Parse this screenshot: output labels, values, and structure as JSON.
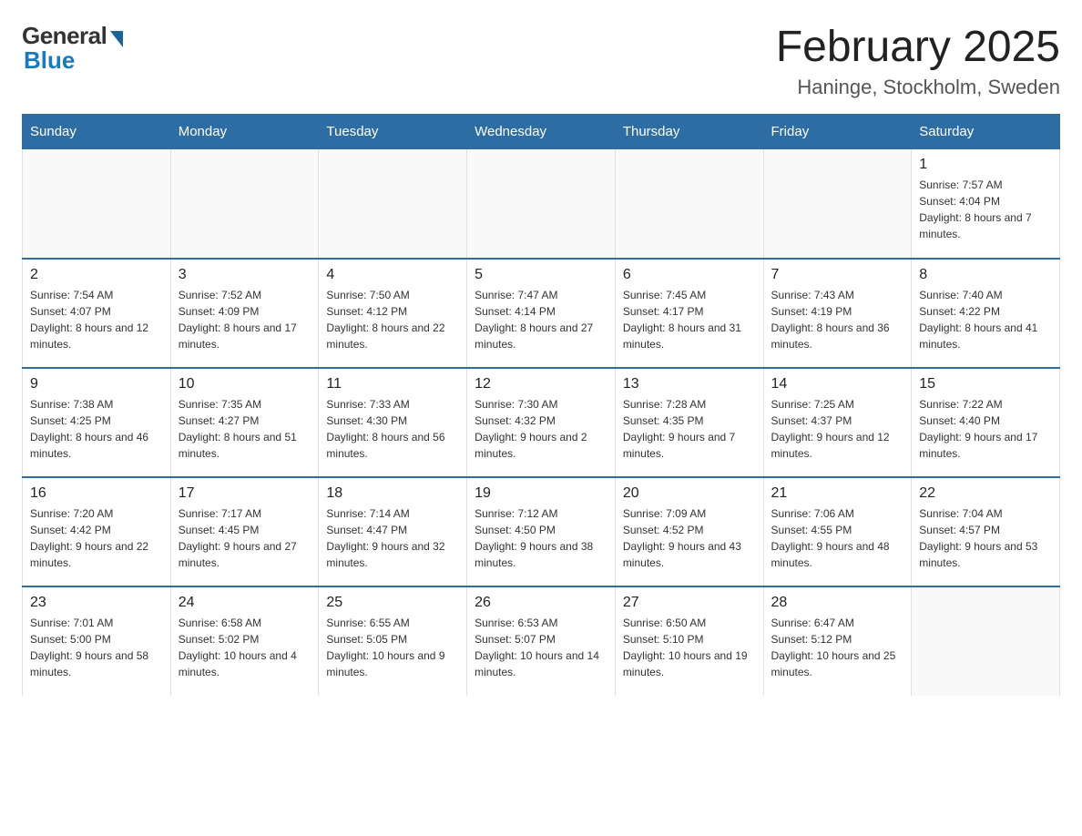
{
  "logo": {
    "general": "General",
    "blue": "Blue"
  },
  "header": {
    "title": "February 2025",
    "subtitle": "Haninge, Stockholm, Sweden"
  },
  "weekdays": [
    "Sunday",
    "Monday",
    "Tuesday",
    "Wednesday",
    "Thursday",
    "Friday",
    "Saturday"
  ],
  "weeks": [
    [
      {
        "day": "",
        "info": ""
      },
      {
        "day": "",
        "info": ""
      },
      {
        "day": "",
        "info": ""
      },
      {
        "day": "",
        "info": ""
      },
      {
        "day": "",
        "info": ""
      },
      {
        "day": "",
        "info": ""
      },
      {
        "day": "1",
        "info": "Sunrise: 7:57 AM\nSunset: 4:04 PM\nDaylight: 8 hours and 7 minutes."
      }
    ],
    [
      {
        "day": "2",
        "info": "Sunrise: 7:54 AM\nSunset: 4:07 PM\nDaylight: 8 hours and 12 minutes."
      },
      {
        "day": "3",
        "info": "Sunrise: 7:52 AM\nSunset: 4:09 PM\nDaylight: 8 hours and 17 minutes."
      },
      {
        "day": "4",
        "info": "Sunrise: 7:50 AM\nSunset: 4:12 PM\nDaylight: 8 hours and 22 minutes."
      },
      {
        "day": "5",
        "info": "Sunrise: 7:47 AM\nSunset: 4:14 PM\nDaylight: 8 hours and 27 minutes."
      },
      {
        "day": "6",
        "info": "Sunrise: 7:45 AM\nSunset: 4:17 PM\nDaylight: 8 hours and 31 minutes."
      },
      {
        "day": "7",
        "info": "Sunrise: 7:43 AM\nSunset: 4:19 PM\nDaylight: 8 hours and 36 minutes."
      },
      {
        "day": "8",
        "info": "Sunrise: 7:40 AM\nSunset: 4:22 PM\nDaylight: 8 hours and 41 minutes."
      }
    ],
    [
      {
        "day": "9",
        "info": "Sunrise: 7:38 AM\nSunset: 4:25 PM\nDaylight: 8 hours and 46 minutes."
      },
      {
        "day": "10",
        "info": "Sunrise: 7:35 AM\nSunset: 4:27 PM\nDaylight: 8 hours and 51 minutes."
      },
      {
        "day": "11",
        "info": "Sunrise: 7:33 AM\nSunset: 4:30 PM\nDaylight: 8 hours and 56 minutes."
      },
      {
        "day": "12",
        "info": "Sunrise: 7:30 AM\nSunset: 4:32 PM\nDaylight: 9 hours and 2 minutes."
      },
      {
        "day": "13",
        "info": "Sunrise: 7:28 AM\nSunset: 4:35 PM\nDaylight: 9 hours and 7 minutes."
      },
      {
        "day": "14",
        "info": "Sunrise: 7:25 AM\nSunset: 4:37 PM\nDaylight: 9 hours and 12 minutes."
      },
      {
        "day": "15",
        "info": "Sunrise: 7:22 AM\nSunset: 4:40 PM\nDaylight: 9 hours and 17 minutes."
      }
    ],
    [
      {
        "day": "16",
        "info": "Sunrise: 7:20 AM\nSunset: 4:42 PM\nDaylight: 9 hours and 22 minutes."
      },
      {
        "day": "17",
        "info": "Sunrise: 7:17 AM\nSunset: 4:45 PM\nDaylight: 9 hours and 27 minutes."
      },
      {
        "day": "18",
        "info": "Sunrise: 7:14 AM\nSunset: 4:47 PM\nDaylight: 9 hours and 32 minutes."
      },
      {
        "day": "19",
        "info": "Sunrise: 7:12 AM\nSunset: 4:50 PM\nDaylight: 9 hours and 38 minutes."
      },
      {
        "day": "20",
        "info": "Sunrise: 7:09 AM\nSunset: 4:52 PM\nDaylight: 9 hours and 43 minutes."
      },
      {
        "day": "21",
        "info": "Sunrise: 7:06 AM\nSunset: 4:55 PM\nDaylight: 9 hours and 48 minutes."
      },
      {
        "day": "22",
        "info": "Sunrise: 7:04 AM\nSunset: 4:57 PM\nDaylight: 9 hours and 53 minutes."
      }
    ],
    [
      {
        "day": "23",
        "info": "Sunrise: 7:01 AM\nSunset: 5:00 PM\nDaylight: 9 hours and 58 minutes."
      },
      {
        "day": "24",
        "info": "Sunrise: 6:58 AM\nSunset: 5:02 PM\nDaylight: 10 hours and 4 minutes."
      },
      {
        "day": "25",
        "info": "Sunrise: 6:55 AM\nSunset: 5:05 PM\nDaylight: 10 hours and 9 minutes."
      },
      {
        "day": "26",
        "info": "Sunrise: 6:53 AM\nSunset: 5:07 PM\nDaylight: 10 hours and 14 minutes."
      },
      {
        "day": "27",
        "info": "Sunrise: 6:50 AM\nSunset: 5:10 PM\nDaylight: 10 hours and 19 minutes."
      },
      {
        "day": "28",
        "info": "Sunrise: 6:47 AM\nSunset: 5:12 PM\nDaylight: 10 hours and 25 minutes."
      },
      {
        "day": "",
        "info": ""
      }
    ]
  ]
}
